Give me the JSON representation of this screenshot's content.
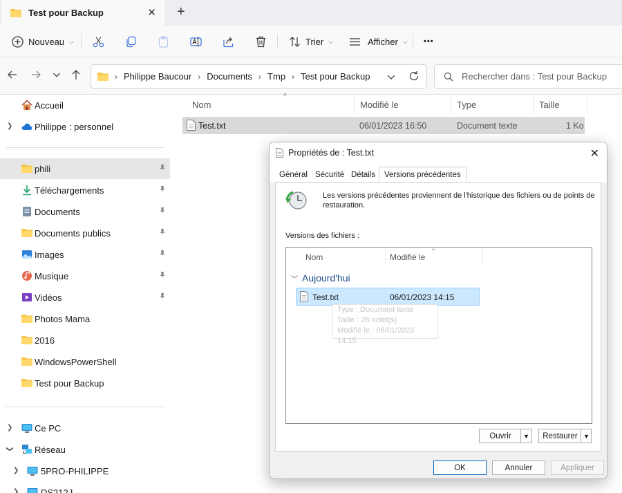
{
  "tab": {
    "title": "Test pour Backup",
    "close": "✕",
    "new": "+"
  },
  "toolbar": {
    "new_label": "Nouveau",
    "sort_label": "Trier",
    "view_label": "Afficher",
    "more": "•••"
  },
  "address": {
    "crumbs": [
      "Philippe Baucour",
      "Documents",
      "Tmp",
      "Test pour Backup"
    ],
    "search_placeholder": "Rechercher dans : Test pour Backup"
  },
  "sidebar": {
    "home": "Accueil",
    "onedrive": "Philippe : personnel",
    "quick": [
      {
        "label": "phili",
        "icon": "folder-icon",
        "pinned": true
      },
      {
        "label": "Téléchargements",
        "icon": "download-icon",
        "pinned": true
      },
      {
        "label": "Documents",
        "icon": "documents-icon",
        "pinned": true
      },
      {
        "label": "Documents publics",
        "icon": "folder-icon",
        "pinned": true
      },
      {
        "label": "Images",
        "icon": "images-icon",
        "pinned": true
      },
      {
        "label": "Musique",
        "icon": "music-icon",
        "pinned": true
      },
      {
        "label": "Vidéos",
        "icon": "videos-icon",
        "pinned": true
      },
      {
        "label": "Photos Mama",
        "icon": "folder-icon",
        "pinned": false
      },
      {
        "label": "2016",
        "icon": "folder-icon",
        "pinned": false
      },
      {
        "label": "WindowsPowerShell",
        "icon": "folder-icon",
        "pinned": false
      },
      {
        "label": "Test pour Backup",
        "icon": "folder-icon",
        "pinned": false
      }
    ],
    "this_pc": "Ce PC",
    "network": "Réseau",
    "net_items": [
      "5PRO-PHILIPPE",
      "DS212J"
    ]
  },
  "filelist": {
    "columns": {
      "name": "Nom",
      "modified": "Modifié le",
      "type": "Type",
      "size": "Taille"
    },
    "rows": [
      {
        "name": "Test.txt",
        "modified": "06/01/2023 16:50",
        "type": "Document texte",
        "size": "1 Ko"
      }
    ]
  },
  "dialog": {
    "title": "Propriétés de : Test.txt",
    "tabs": [
      "Général",
      "Sécurité",
      "Détails",
      "Versions précédentes"
    ],
    "active_tab": "Versions précédentes",
    "description": "Les versions précédentes proviennent de l'historique des fichiers ou de points de restauration.",
    "versions_label": "Versions des fichiers :",
    "list_columns": {
      "name": "Nom",
      "modified": "Modifié le"
    },
    "group": "Aujourd'hui",
    "version": {
      "name": "Test.txt",
      "modified": "06/01/2023 14:15"
    },
    "tooltip": {
      "type": "Type : Document texte",
      "size": "Taille : 28 octet(s)",
      "modified": "Modifié le : 06/01/2023 14:15"
    },
    "buttons": {
      "open": "Ouvrir",
      "restore": "Restaurer",
      "ok": "OK",
      "cancel": "Annuler",
      "apply": "Appliquer"
    }
  }
}
